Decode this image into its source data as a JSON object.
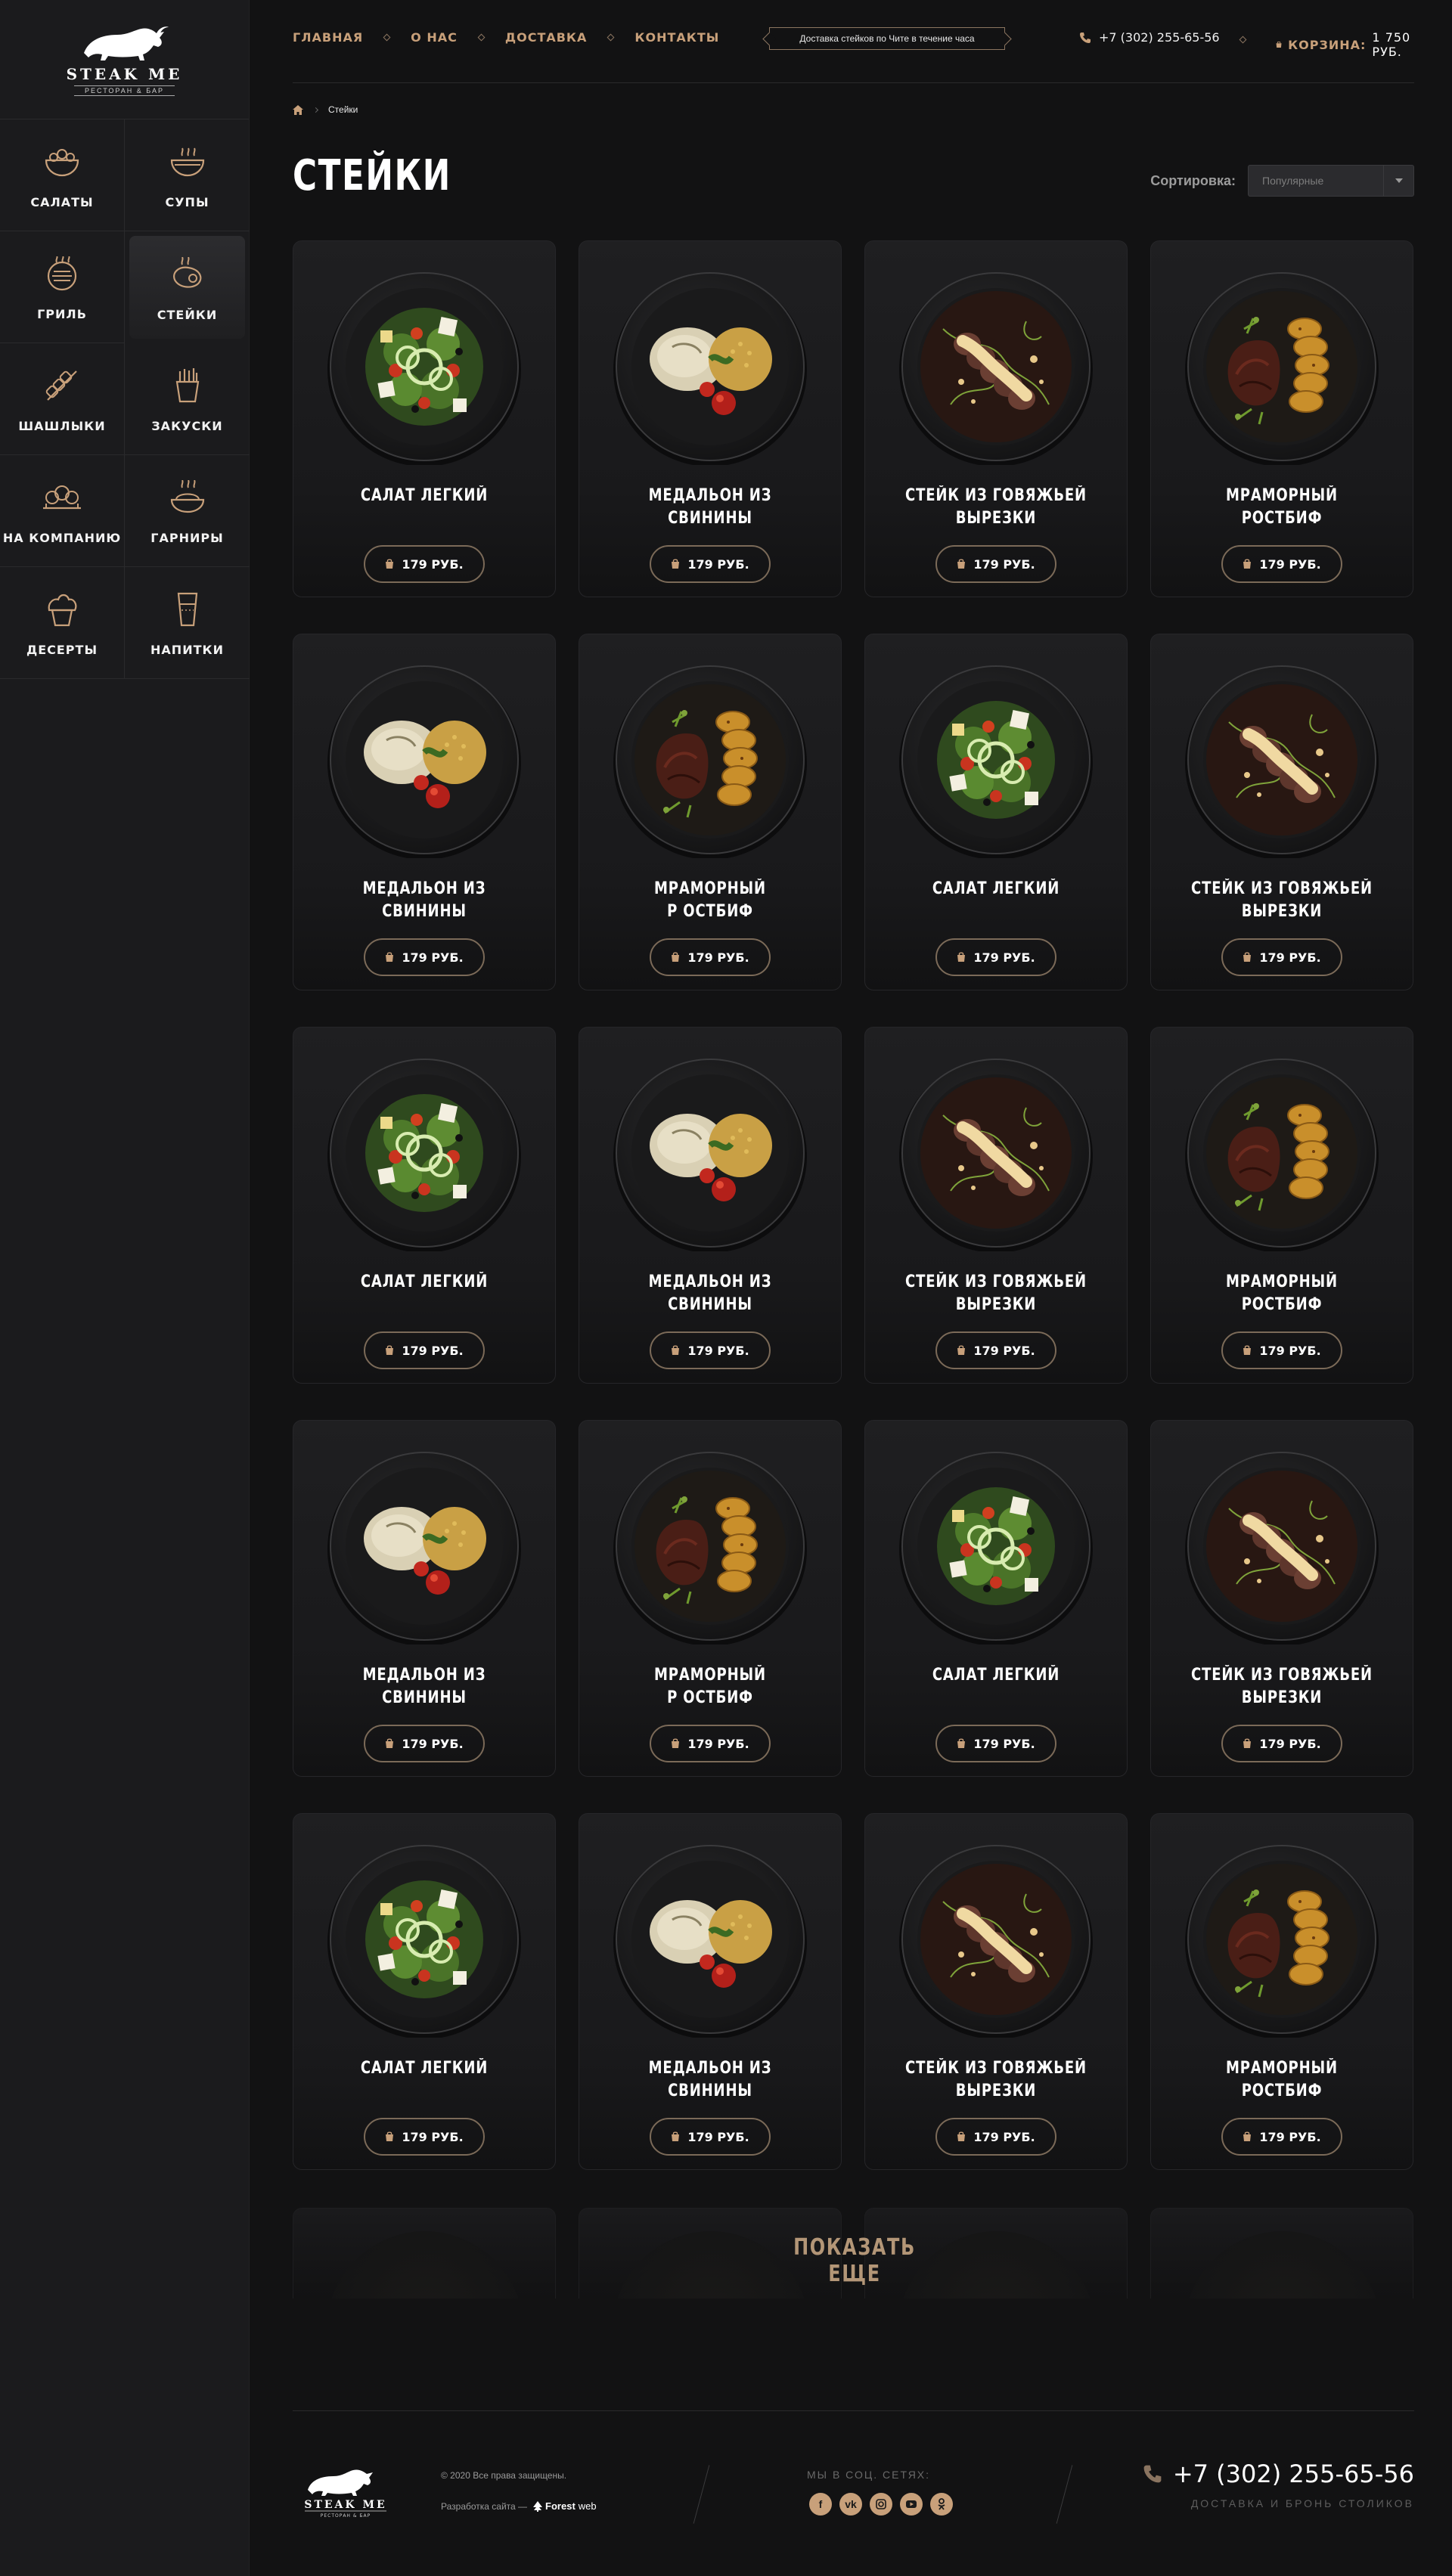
{
  "brand": {
    "name": "STEAK ME",
    "tagline": "РЕСТОРАН & БАР"
  },
  "sidebar": {
    "categories": [
      {
        "label": "САЛАТЫ",
        "icon": "salad-bowl-icon",
        "active": false
      },
      {
        "label": "СУПЫ",
        "icon": "soup-bowl-icon",
        "active": false
      },
      {
        "label": "ГРИЛЬ",
        "icon": "grill-icon",
        "active": false
      },
      {
        "label": "СТЕЙКИ",
        "icon": "steak-icon",
        "active": true
      },
      {
        "label": "ШАШЛЫКИ",
        "icon": "skewer-icon",
        "active": false
      },
      {
        "label": "ЗАКУСКИ",
        "icon": "fries-icon",
        "active": false
      },
      {
        "label": "НА КОМПАНИЮ",
        "icon": "party-platter-icon",
        "active": false
      },
      {
        "label": "ГАРНИРЫ",
        "icon": "side-dish-icon",
        "active": false
      },
      {
        "label": "ДЕСЕРТЫ",
        "icon": "cupcake-icon",
        "active": false
      },
      {
        "label": "НАПИТКИ",
        "icon": "drink-glass-icon",
        "active": false
      }
    ]
  },
  "header": {
    "nav": [
      "ГЛАВНАЯ",
      "О НАС",
      "ДОСТАВКА",
      "КОНТАКТЫ"
    ],
    "delivery_note": "Доставка стейков по Чите в течение часа",
    "phone": "+7 (302) 255-65-56",
    "cart_label": "КОРЗИНА:",
    "cart_value": "1 750 РУБ."
  },
  "breadcrumb": {
    "current": "Стейки"
  },
  "page_title": "СТЕЙКИ",
  "sort": {
    "label": "Сортировка:",
    "selected": "Популярные"
  },
  "products": [
    {
      "line1": "САЛАТ ЛЕГКИЙ",
      "line2": "",
      "price": "179 РУБ.",
      "dish": "salad"
    },
    {
      "line1": "МЕДАЛЬОН ИЗ",
      "line2": "СВИНИНЫ",
      "price": "179 РУБ.",
      "dish": "medallion"
    },
    {
      "line1": "СТЕЙК ИЗ ГОВЯЖЬЕЙ",
      "line2": "ВЫРЕЗКИ",
      "price": "179 РУБ.",
      "dish": "tenderloin"
    },
    {
      "line1": "МРАМОРНЫЙ",
      "line2": "РОСТБИФ",
      "price": "179 РУБ.",
      "dish": "roastbeef"
    },
    {
      "line1": "МЕДАЛЬОН ИЗ",
      "line2": "СВИНИНЫ",
      "price": "179 РУБ.",
      "dish": "medallion"
    },
    {
      "line1": "МРАМОРНЫЙ",
      "line2": "Р ОСТБИФ",
      "price": "179 РУБ.",
      "dish": "roastbeef"
    },
    {
      "line1": "САЛАТ ЛЕГКИЙ",
      "line2": "",
      "price": "179 РУБ.",
      "dish": "salad"
    },
    {
      "line1": "СТЕЙК ИЗ ГОВЯЖЬЕЙ",
      "line2": "ВЫРЕЗКИ",
      "price": "179 РУБ.",
      "dish": "tenderloin"
    },
    {
      "line1": "САЛАТ ЛЕГКИЙ",
      "line2": "",
      "price": "179 РУБ.",
      "dish": "salad"
    },
    {
      "line1": "МЕДАЛЬОН ИЗ",
      "line2": "СВИНИНЫ",
      "price": "179 РУБ.",
      "dish": "medallion"
    },
    {
      "line1": "СТЕЙК ИЗ ГОВЯЖЬЕЙ",
      "line2": "ВЫРЕЗКИ",
      "price": "179 РУБ.",
      "dish": "tenderloin"
    },
    {
      "line1": "МРАМОРНЫЙ",
      "line2": "РОСТБИФ",
      "price": "179 РУБ.",
      "dish": "roastbeef"
    },
    {
      "line1": "МЕДАЛЬОН ИЗ",
      "line2": "СВИНИНЫ",
      "price": "179 РУБ.",
      "dish": "medallion"
    },
    {
      "line1": "МРАМОРНЫЙ",
      "line2": "Р ОСТБИФ",
      "price": "179 РУБ.",
      "dish": "roastbeef"
    },
    {
      "line1": "САЛАТ ЛЕГКИЙ",
      "line2": "",
      "price": "179 РУБ.",
      "dish": "salad"
    },
    {
      "line1": "СТЕЙК ИЗ ГОВЯЖЬЕЙ",
      "line2": "ВЫРЕЗКИ",
      "price": "179 РУБ.",
      "dish": "tenderloin"
    },
    {
      "line1": "САЛАТ ЛЕГКИЙ",
      "line2": "",
      "price": "179 РУБ.",
      "dish": "salad"
    },
    {
      "line1": "МЕДАЛЬОН ИЗ",
      "line2": "СВИНИНЫ",
      "price": "179 РУБ.",
      "dish": "medallion"
    },
    {
      "line1": "СТЕЙК ИЗ ГОВЯЖЬЕЙ",
      "line2": "ВЫРЕЗКИ",
      "price": "179 РУБ.",
      "dish": "tenderloin"
    },
    {
      "line1": "МРАМОРНЫЙ",
      "line2": "РОСТБИФ",
      "price": "179 РУБ.",
      "dish": "roastbeef"
    }
  ],
  "show_more": "ПОКАЗАТЬ ЕЩЕ",
  "footer": {
    "copyright": "© 2020 Все права защищены.",
    "dev_label": "Разработка сайта —",
    "dev_name_bold": "Forest",
    "dev_name_light": "web",
    "social_title": "МЫ В СОЦ. СЕТЯХ:",
    "social": [
      "facebook-icon",
      "vk-icon",
      "instagram-icon",
      "youtube-icon",
      "odnoklassniki-icon"
    ],
    "phone": "+7 (302) 255-65-56",
    "phone_note": "ДОСТАВКА И БРОНЬ СТОЛИКОВ"
  },
  "colors": {
    "accent": "#c8a07a",
    "background": "#121213",
    "sidebar": "#1b1b1d",
    "card": "#1f1f21"
  }
}
